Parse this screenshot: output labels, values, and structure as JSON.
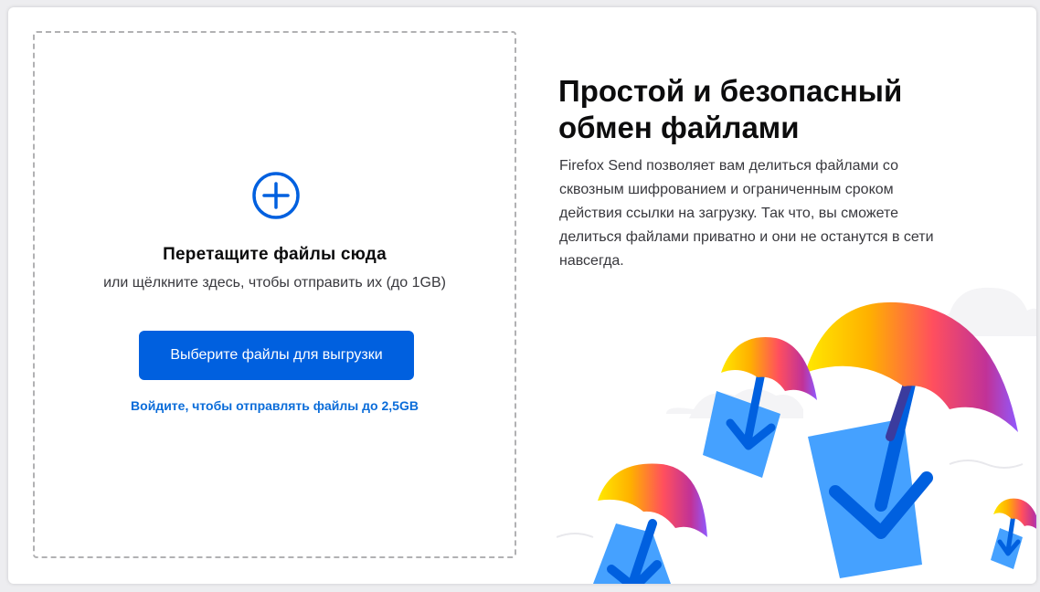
{
  "upload": {
    "title": "Перетащите файлы сюда",
    "subtitle": "или щёлкните здесь, чтобы отправить их (до 1GB)",
    "button_label": "Выберите файлы для выгрузки",
    "signin_link": "Войдите, чтобы отправлять файлы до 2,5GB",
    "icon": "plus-circle-icon"
  },
  "intro": {
    "title_line1": "Простой и безопасный",
    "title_line2": "обмен файлами",
    "description": "Firefox Send позволяет вам делиться файлами со сквозным шифрованием и ограниченным сроком действия ссылки на загрузку. Так что, вы сможете делиться файлами приватно и они не останутся в сети навсегда."
  },
  "illustration": {
    "icon": "parachute-files-illustration"
  },
  "colors": {
    "accent": "#0060df",
    "link": "#0a6cd9",
    "page_background": "#ededf0",
    "file_blue": "#45a1ff",
    "arrow_blue": "#0060df"
  }
}
